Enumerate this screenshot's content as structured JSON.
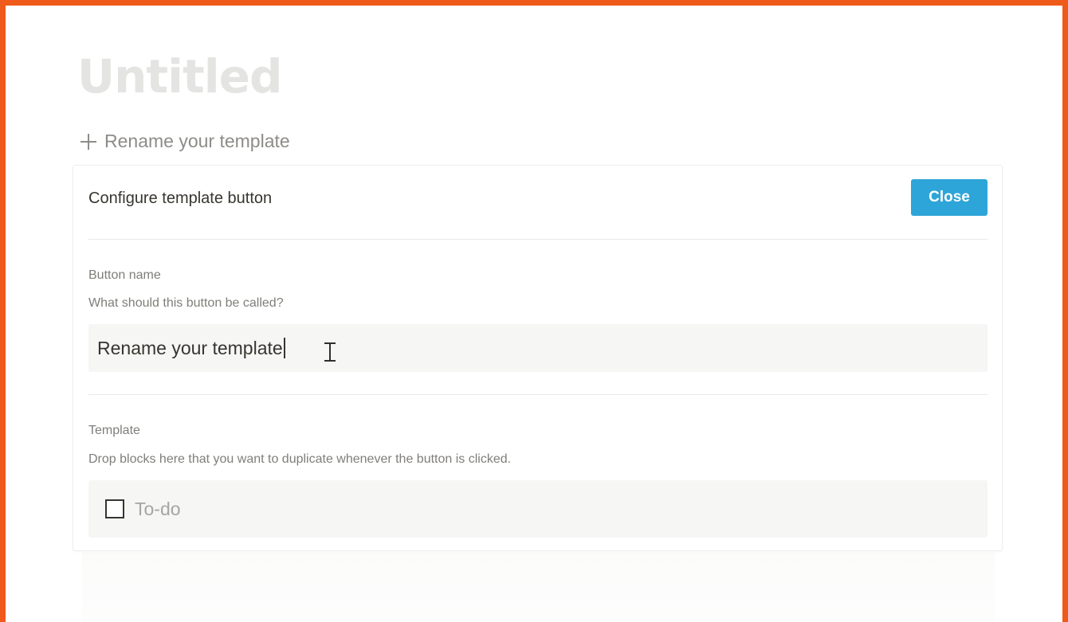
{
  "page": {
    "title": "Untitled"
  },
  "template_button": {
    "label": "Rename your template",
    "icon": "plus-icon"
  },
  "config_panel": {
    "title": "Configure template button",
    "close_label": "Close",
    "close_color": "#2ea5d8",
    "button_name": {
      "label": "Button name",
      "help": "What should this button be called?",
      "value": "Rename your template"
    },
    "template": {
      "label": "Template",
      "help": "Drop blocks here that you want to duplicate whenever the button is clicked.",
      "todo_placeholder": "To-do",
      "todo_checked": false
    }
  },
  "accent_color": "#ef5a1a"
}
